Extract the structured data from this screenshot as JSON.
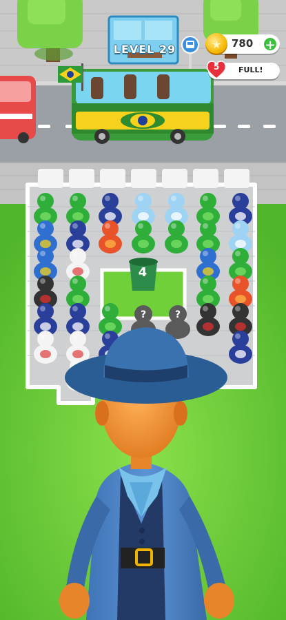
{
  "hud": {
    "level_text": "LEVEL 29",
    "coins": "780",
    "add_coins_icon": "plus-icon",
    "lives_count": "5",
    "lives_status": "FULL!"
  },
  "board": {
    "holding_slot_count": "4",
    "mystery_symbol": "?"
  },
  "icons": {
    "coin": "star-coin-icon",
    "heart": "heart-icon",
    "bus_stop": "bus-stop-icon",
    "flag": "brazil-flag-icon"
  },
  "colors": {
    "grass": "#6fcf3a",
    "road": "#9aa0a6",
    "bus_green": "#3a9b3a",
    "brazil_yellow": "#f6d21c",
    "accent_blue": "#2e6aa3"
  }
}
